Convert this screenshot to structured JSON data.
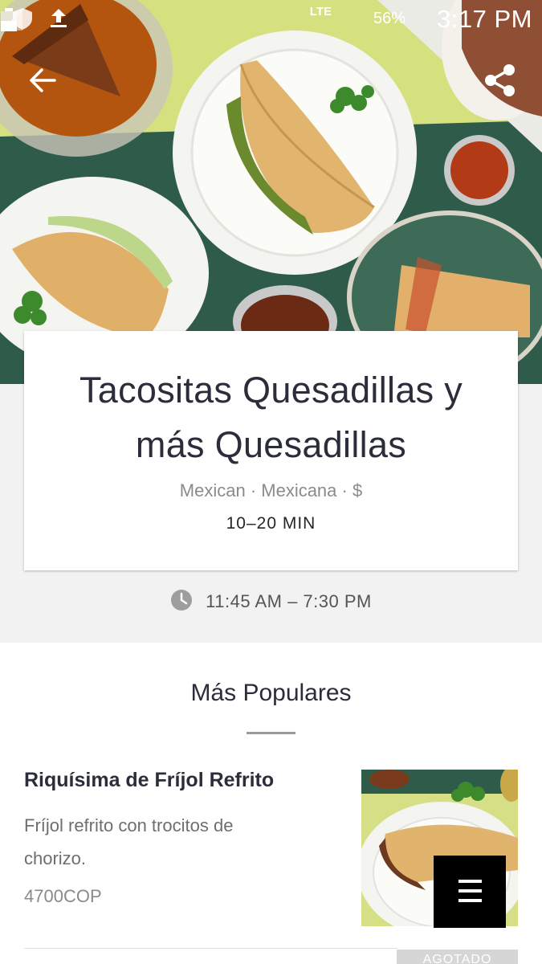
{
  "status_bar": {
    "network": "LTE",
    "battery_pct": "56%",
    "time": "3:17 PM"
  },
  "restaurant": {
    "name": "Tacositas Quesadillas y más Quesadillas",
    "cuisine": "Mexican · Mexicana · $",
    "delivery_time": "10–20 MIN",
    "hours": "11:45 AM – 7:30 PM"
  },
  "menu": {
    "section_title": "Más Populares",
    "items": [
      {
        "name": "Riquísima de Fríjol Refrito",
        "description": "Fríjol refrito con trocitos de chorizo.",
        "price": "4700COP"
      }
    ],
    "next_button_label": "AGOTADO"
  },
  "icons": {
    "back": "arrow-left-icon",
    "share": "share-icon",
    "clock": "clock-icon",
    "menu": "hamburger-menu-icon"
  },
  "colors": {
    "title_text": "#2b2d3a",
    "fab": "#000000"
  }
}
